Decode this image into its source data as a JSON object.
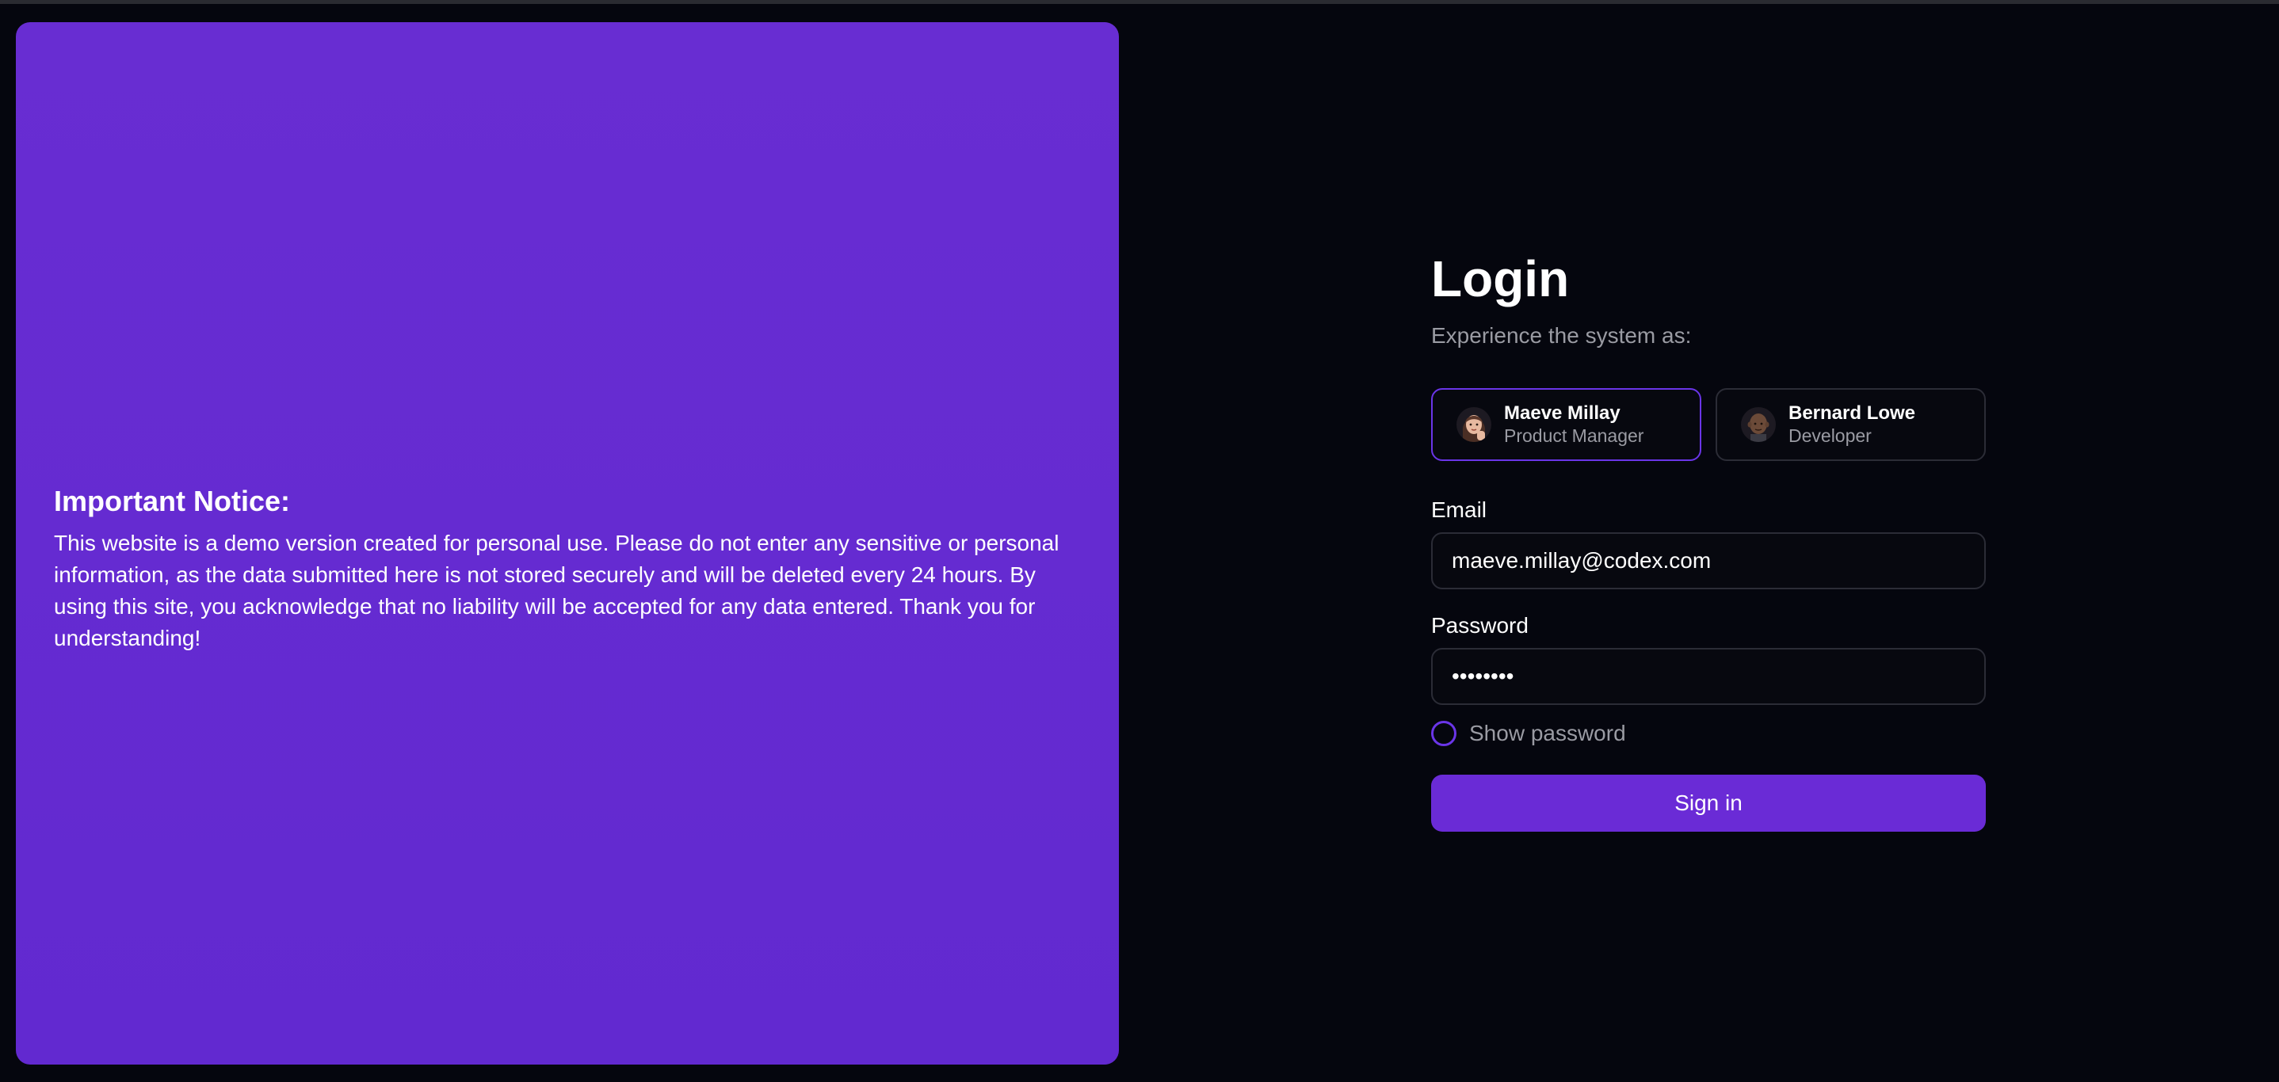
{
  "notice": {
    "title": "Important Notice:",
    "body": "This website is a demo version created for personal use. Please do not enter any sensitive or personal information, as the data submitted here is not stored securely and will be deleted every 24 hours. By using this site, you acknowledge that no liability will be accepted for any data entered. Thank you for understanding!"
  },
  "login": {
    "title": "Login",
    "subtitle": "Experience the system as:",
    "personas": [
      {
        "name": "Maeve Millay",
        "role": "Product Manager",
        "selected": true,
        "icon": "woman-emoji-avatar-icon"
      },
      {
        "name": "Bernard Lowe",
        "role": "Developer",
        "selected": false,
        "icon": "man-emoji-avatar-icon"
      }
    ],
    "email_label": "Email",
    "email_value": "maeve.millay@codex.com",
    "password_label": "Password",
    "password_value": "••••••••",
    "show_password_label": "Show password",
    "signin_label": "Sign in"
  },
  "colors": {
    "accent": "#6a2bd6",
    "panel": "#652bd1",
    "background": "#05060e",
    "muted_text": "#9a9ba3",
    "border": "#2b2c36"
  }
}
